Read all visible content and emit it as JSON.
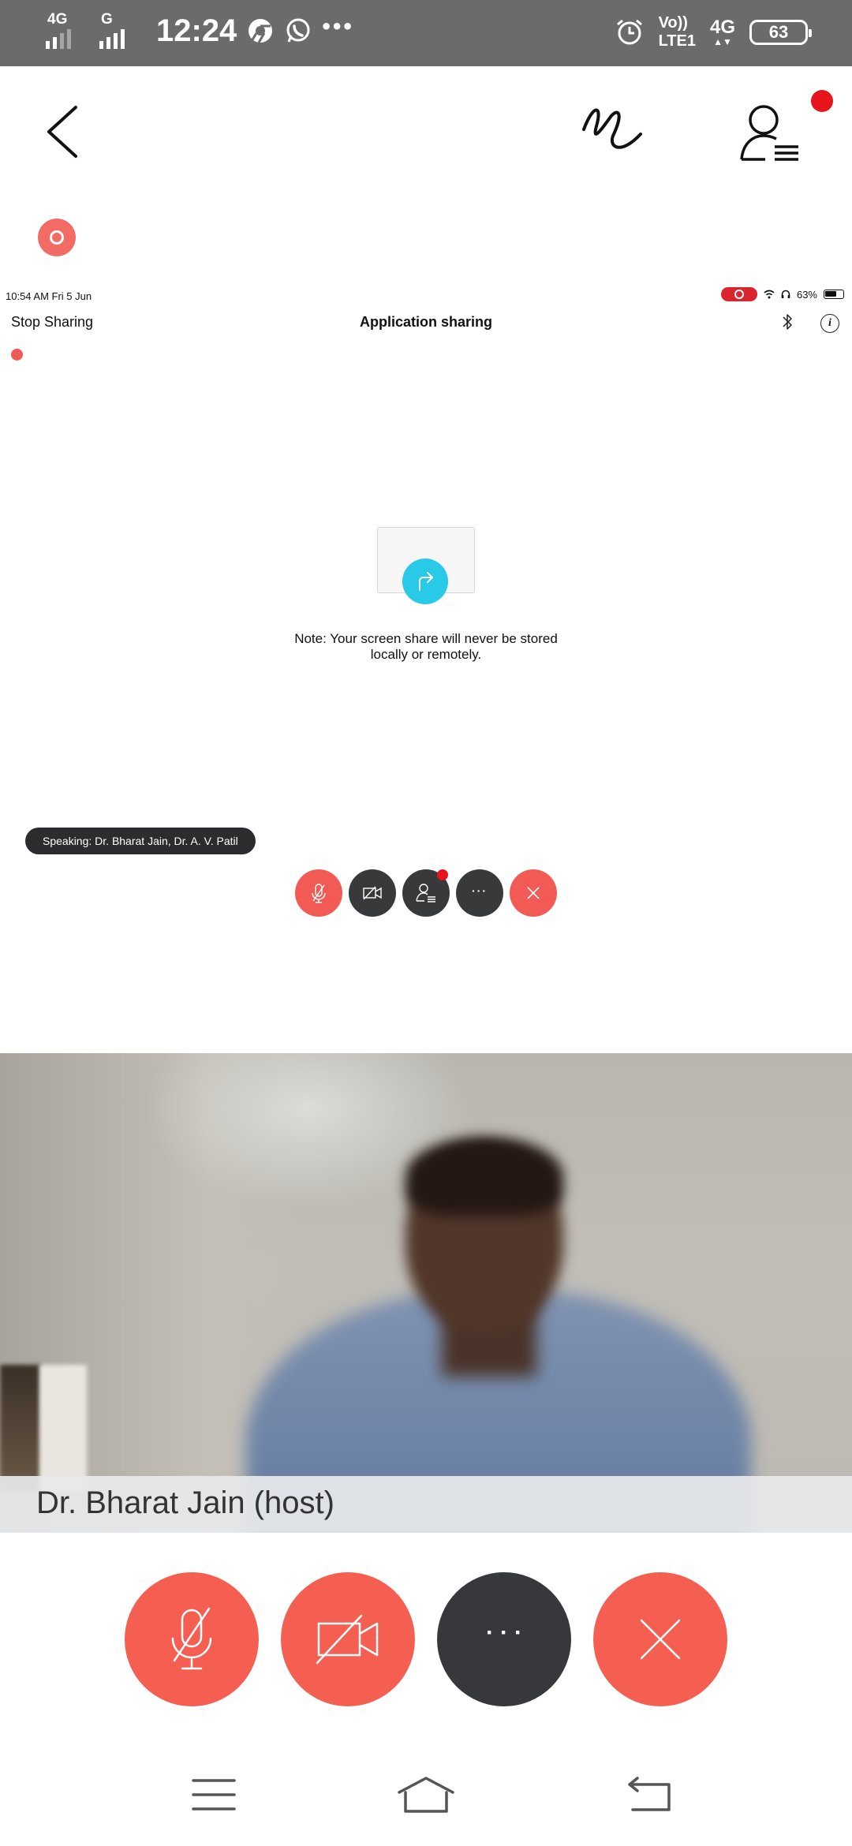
{
  "status_bar": {
    "net1_label": "4G",
    "net2_label": "G",
    "time": "12:24",
    "volte_top": "Vo))",
    "volte_bottom": "LTE1",
    "net_right": "4G",
    "battery": "63"
  },
  "shared_screen": {
    "device_time": "10:54 AM   Fri 5 Jun",
    "device_battery": "63%",
    "stop_sharing_label": "Stop Sharing",
    "title": "Application sharing",
    "note_line1": "Note: Your screen share will never be stored",
    "note_line2": "locally or remotely.",
    "speaking_label": "Speaking: Dr. Bharat Jain, Dr. A. V. Patil",
    "more_label": "···"
  },
  "video": {
    "participant_name": "Dr. Bharat Jain (host)"
  },
  "controls": {
    "more_label": "···"
  },
  "colors": {
    "status_bar_bg": "#6b6b6b",
    "control_red": "#f45f52",
    "control_dark": "#37383c",
    "notification_red": "#e8141c",
    "share_cyan": "#29c9e8"
  },
  "icons": [
    "back-icon",
    "annotate-icon",
    "participants-icon",
    "mic-muted-icon",
    "video-off-icon",
    "more-icon",
    "end-call-icon",
    "menu-icon",
    "home-icon",
    "back-nav-icon"
  ]
}
